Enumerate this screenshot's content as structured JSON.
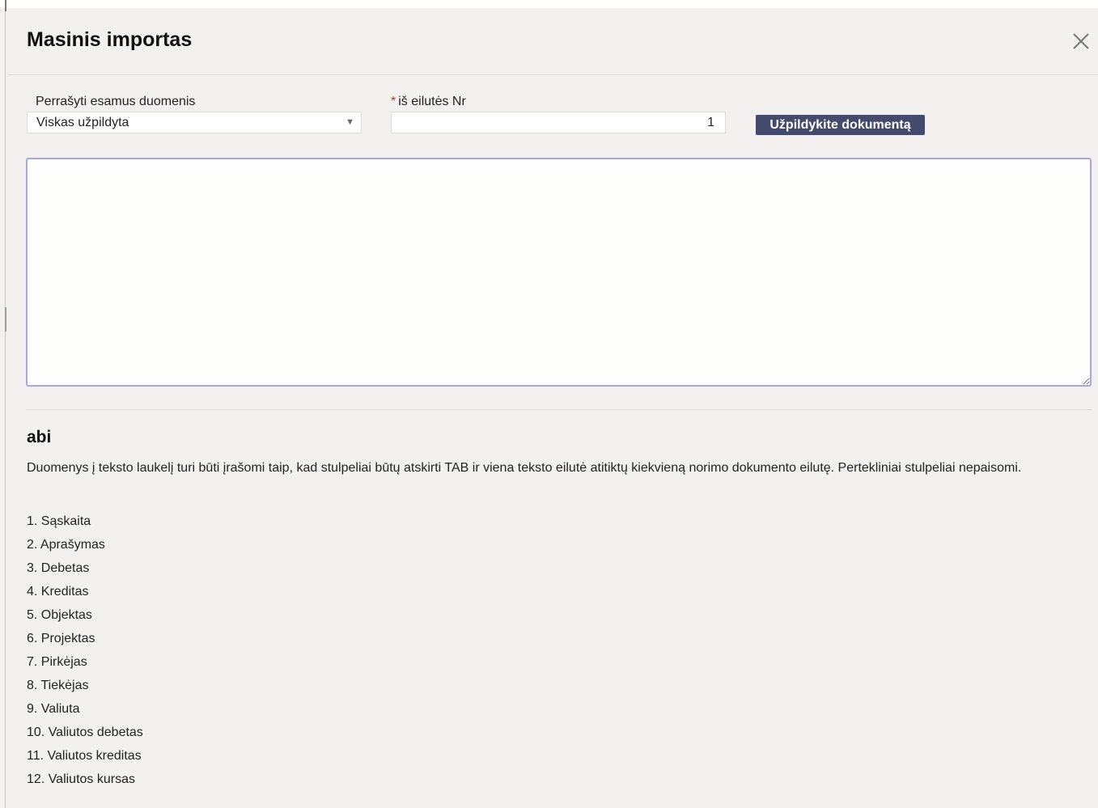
{
  "dialog": {
    "title": "Masinis importas",
    "close_icon": "close-icon"
  },
  "form": {
    "overwrite_label": "Perrašyti esamus duomenis",
    "overwrite_value": "Viskas užpildyta",
    "row_required_marker": "*",
    "row_label": "iš eilutės Nr",
    "row_value": "1",
    "fill_button_label": "Užpildykite dokumentą",
    "textarea_value": ""
  },
  "help": {
    "heading": "abi",
    "description": "Duomenys į teksto laukelį turi būti įrašomi taip, kad stulpeliai būtų atskirti TAB ir viena teksto eilutė atitiktų kiekvieną norimo dokumento eilutę. Pertekliniai stulpeliai nepaisomi.",
    "columns": [
      "1. Sąskaita",
      "2. Aprašymas",
      "3. Debetas",
      "4. Kreditas",
      "5. Objektas",
      "6. Projektas",
      "7. Pirkėjas",
      "8. Tiekėjas",
      "9. Valiuta",
      "10. Valiutos debetas",
      "11. Valiutos kreditas",
      "12. Valiutos kursas"
    ]
  },
  "colors": {
    "button_bg": "#434a6b",
    "textarea_focus_border": "#a9a6e3",
    "required_star": "#d9262c",
    "background": "#f2f1f0"
  }
}
